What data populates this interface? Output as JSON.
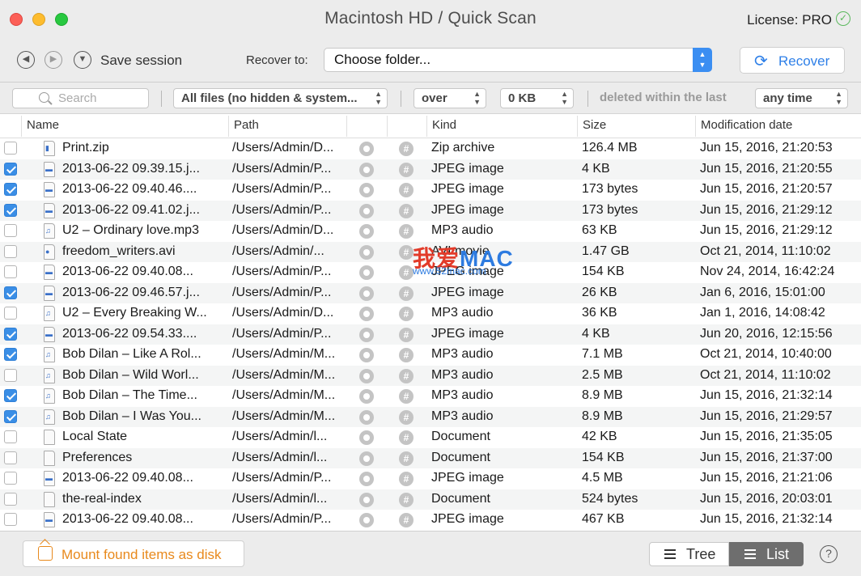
{
  "window": {
    "title": "Macintosh HD / Quick Scan",
    "license": "License: PRO"
  },
  "toolbar": {
    "save_session_label": "Save session",
    "recover_to_label": "Recover to:",
    "folder_value": "Choose folder...",
    "recover_label": "Recover"
  },
  "filters": {
    "search_placeholder": "Search",
    "files_filter": "All files (no hidden & system...",
    "size_compare": "over",
    "size_value": "0 KB",
    "deleted_label": "deleted within the last",
    "time_value": "any time"
  },
  "columns": {
    "name": "Name",
    "path": "Path",
    "kind": "Kind",
    "size": "Size",
    "modified": "Modification date"
  },
  "rows": [
    {
      "name": "Print.zip",
      "path": "/Users/Admin/D...",
      "kind": "Zip archive",
      "size": "126.4 MB",
      "date": "Jun 15, 2016, 21:20:53",
      "checked": false,
      "icon": "zip-file-icon"
    },
    {
      "name": "2013-06-22 09.39.15.j...",
      "path": "/Users/Admin/P...",
      "kind": "JPEG image",
      "size": "4 KB",
      "date": "Jun 15, 2016, 21:20:55",
      "checked": true,
      "icon": "image-file-icon"
    },
    {
      "name": "2013-06-22 09.40.46....",
      "path": "/Users/Admin/P...",
      "kind": "JPEG image",
      "size": "173 bytes",
      "date": "Jun 15, 2016, 21:20:57",
      "checked": true,
      "icon": "image-file-icon"
    },
    {
      "name": "2013-06-22 09.41.02.j...",
      "path": "/Users/Admin/P...",
      "kind": "JPEG image",
      "size": "173 bytes",
      "date": "Jun 15, 2016, 21:29:12",
      "checked": true,
      "icon": "image-file-icon"
    },
    {
      "name": "U2 – Ordinary love.mp3",
      "path": "/Users/Admin/D...",
      "kind": "MP3 audio",
      "size": "63 KB",
      "date": "Jun 15, 2016, 21:29:12",
      "checked": false,
      "icon": "audio-file-icon"
    },
    {
      "name": "freedom_writers.avi",
      "path": "/Users/Admin/...",
      "kind": "AVI movie",
      "size": "1.47 GB",
      "date": "Oct 21, 2014, 11:10:02",
      "checked": false,
      "icon": "video-file-icon"
    },
    {
      "name": "2013-06-22 09.40.08...",
      "path": "/Users/Admin/P...",
      "kind": "JPEG image",
      "size": "154 KB",
      "date": "Nov 24, 2014, 16:42:24",
      "checked": false,
      "icon": "image-file-icon"
    },
    {
      "name": "2013-06-22 09.46.57.j...",
      "path": "/Users/Admin/P...",
      "kind": "JPEG image",
      "size": "26 KB",
      "date": "Jan 6, 2016, 15:01:00",
      "checked": true,
      "icon": "image-file-icon"
    },
    {
      "name": "U2 – Every Breaking W...",
      "path": "/Users/Admin/D...",
      "kind": "MP3 audio",
      "size": "36 KB",
      "date": "Jan 1, 2016, 14:08:42",
      "checked": false,
      "icon": "audio-file-icon"
    },
    {
      "name": "2013-06-22 09.54.33....",
      "path": "/Users/Admin/P...",
      "kind": "JPEG image",
      "size": "4 KB",
      "date": "Jun 20, 2016, 12:15:56",
      "checked": true,
      "icon": "image-file-icon"
    },
    {
      "name": "Bob Dilan – Like A Rol...",
      "path": "/Users/Admin/M...",
      "kind": "MP3 audio",
      "size": "7.1 MB",
      "date": "Oct 21, 2014, 10:40:00",
      "checked": true,
      "icon": "audio-file-icon"
    },
    {
      "name": "Bob Dilan – Wild Worl...",
      "path": "/Users/Admin/M...",
      "kind": "MP3 audio",
      "size": "2.5 MB",
      "date": "Oct 21, 2014, 11:10:02",
      "checked": false,
      "icon": "audio-file-icon"
    },
    {
      "name": "Bob Dilan – The Time...",
      "path": "/Users/Admin/M...",
      "kind": "MP3 audio",
      "size": "8.9 MB",
      "date": "Jun 15, 2016, 21:32:14",
      "checked": true,
      "icon": "audio-file-icon"
    },
    {
      "name": "Bob Dilan – I Was You...",
      "path": "/Users/Admin/M...",
      "kind": "MP3 audio",
      "size": "8.9 MB",
      "date": "Jun 15, 2016, 21:29:57",
      "checked": true,
      "icon": "audio-file-icon"
    },
    {
      "name": "Local State",
      "path": "/Users/Admin/l...",
      "kind": "Document",
      "size": "42 KB",
      "date": "Jun 15, 2016, 21:35:05",
      "checked": false,
      "icon": "document-file-icon"
    },
    {
      "name": "Preferences",
      "path": "/Users/Admin/l...",
      "kind": "Document",
      "size": "154 KB",
      "date": "Jun 15, 2016, 21:37:00",
      "checked": false,
      "icon": "document-file-icon"
    },
    {
      "name": "2013-06-22 09.40.08...",
      "path": "/Users/Admin/P...",
      "kind": "JPEG image",
      "size": "4.5 MB",
      "date": "Jun 15, 2016, 21:21:06",
      "checked": false,
      "icon": "image-file-icon"
    },
    {
      "name": "the-real-index",
      "path": "/Users/Admin/l...",
      "kind": "Document",
      "size": "524 bytes",
      "date": "Jun 15, 2016, 20:03:01",
      "checked": false,
      "icon": "document-file-icon"
    },
    {
      "name": "2013-06-22 09.40.08...",
      "path": "/Users/Admin/P...",
      "kind": "JPEG image",
      "size": "467 KB",
      "date": "Jun 15, 2016, 21:32:14",
      "checked": false,
      "icon": "image-file-icon"
    }
  ],
  "bottom": {
    "mount_label": "Mount found items as disk",
    "tree_label": "Tree",
    "list_label": "List",
    "help_label": "?"
  },
  "watermark": {
    "cn": "我爱",
    "mac": "MAC",
    "url": "www.52mac.com"
  },
  "colors": {
    "accent": "#2f80e8",
    "checkbox_on": "#3a8ee6",
    "mount_orange": "#e8891c",
    "selected_segment": "#6e6e6e"
  }
}
